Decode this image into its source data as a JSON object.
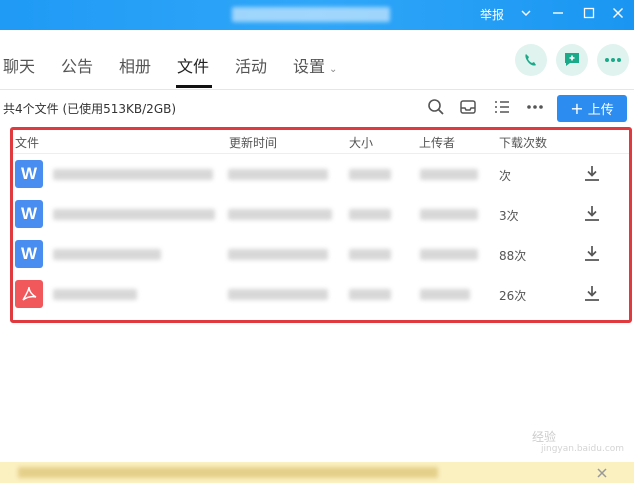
{
  "titlebar": {
    "report_label": "举报",
    "colors": {
      "background": "#1f9af5"
    }
  },
  "tabs": [
    {
      "label": "聊天"
    },
    {
      "label": "公告"
    },
    {
      "label": "相册"
    },
    {
      "label": "文件",
      "active": true
    },
    {
      "label": "活动"
    },
    {
      "label": "设置"
    }
  ],
  "toolbar": {
    "summary": "共4个文件 (已使用513KB/2GB)",
    "upload_label": "上传"
  },
  "table": {
    "headers": [
      "文件",
      "更新时间",
      "大小",
      "上传者",
      "下载次数"
    ],
    "rows": [
      {
        "icon": "word-file-icon",
        "icon_text": "W",
        "downloads": "次"
      },
      {
        "icon": "word-file-icon",
        "icon_text": "W",
        "downloads": "3次"
      },
      {
        "icon": "word-file-icon",
        "icon_text": "W",
        "downloads": "88次"
      },
      {
        "icon": "pdf-file-icon",
        "icon_text": "",
        "downloads": "26次"
      }
    ]
  },
  "watermark": {
    "text": "经验",
    "url": "jingyan.baidu.com"
  },
  "colors": {
    "accent": "#2d8cf0",
    "highlight_border": "#e0393e",
    "call_green": "#1aaa8a",
    "notice_bg": "#fbf0c0"
  }
}
